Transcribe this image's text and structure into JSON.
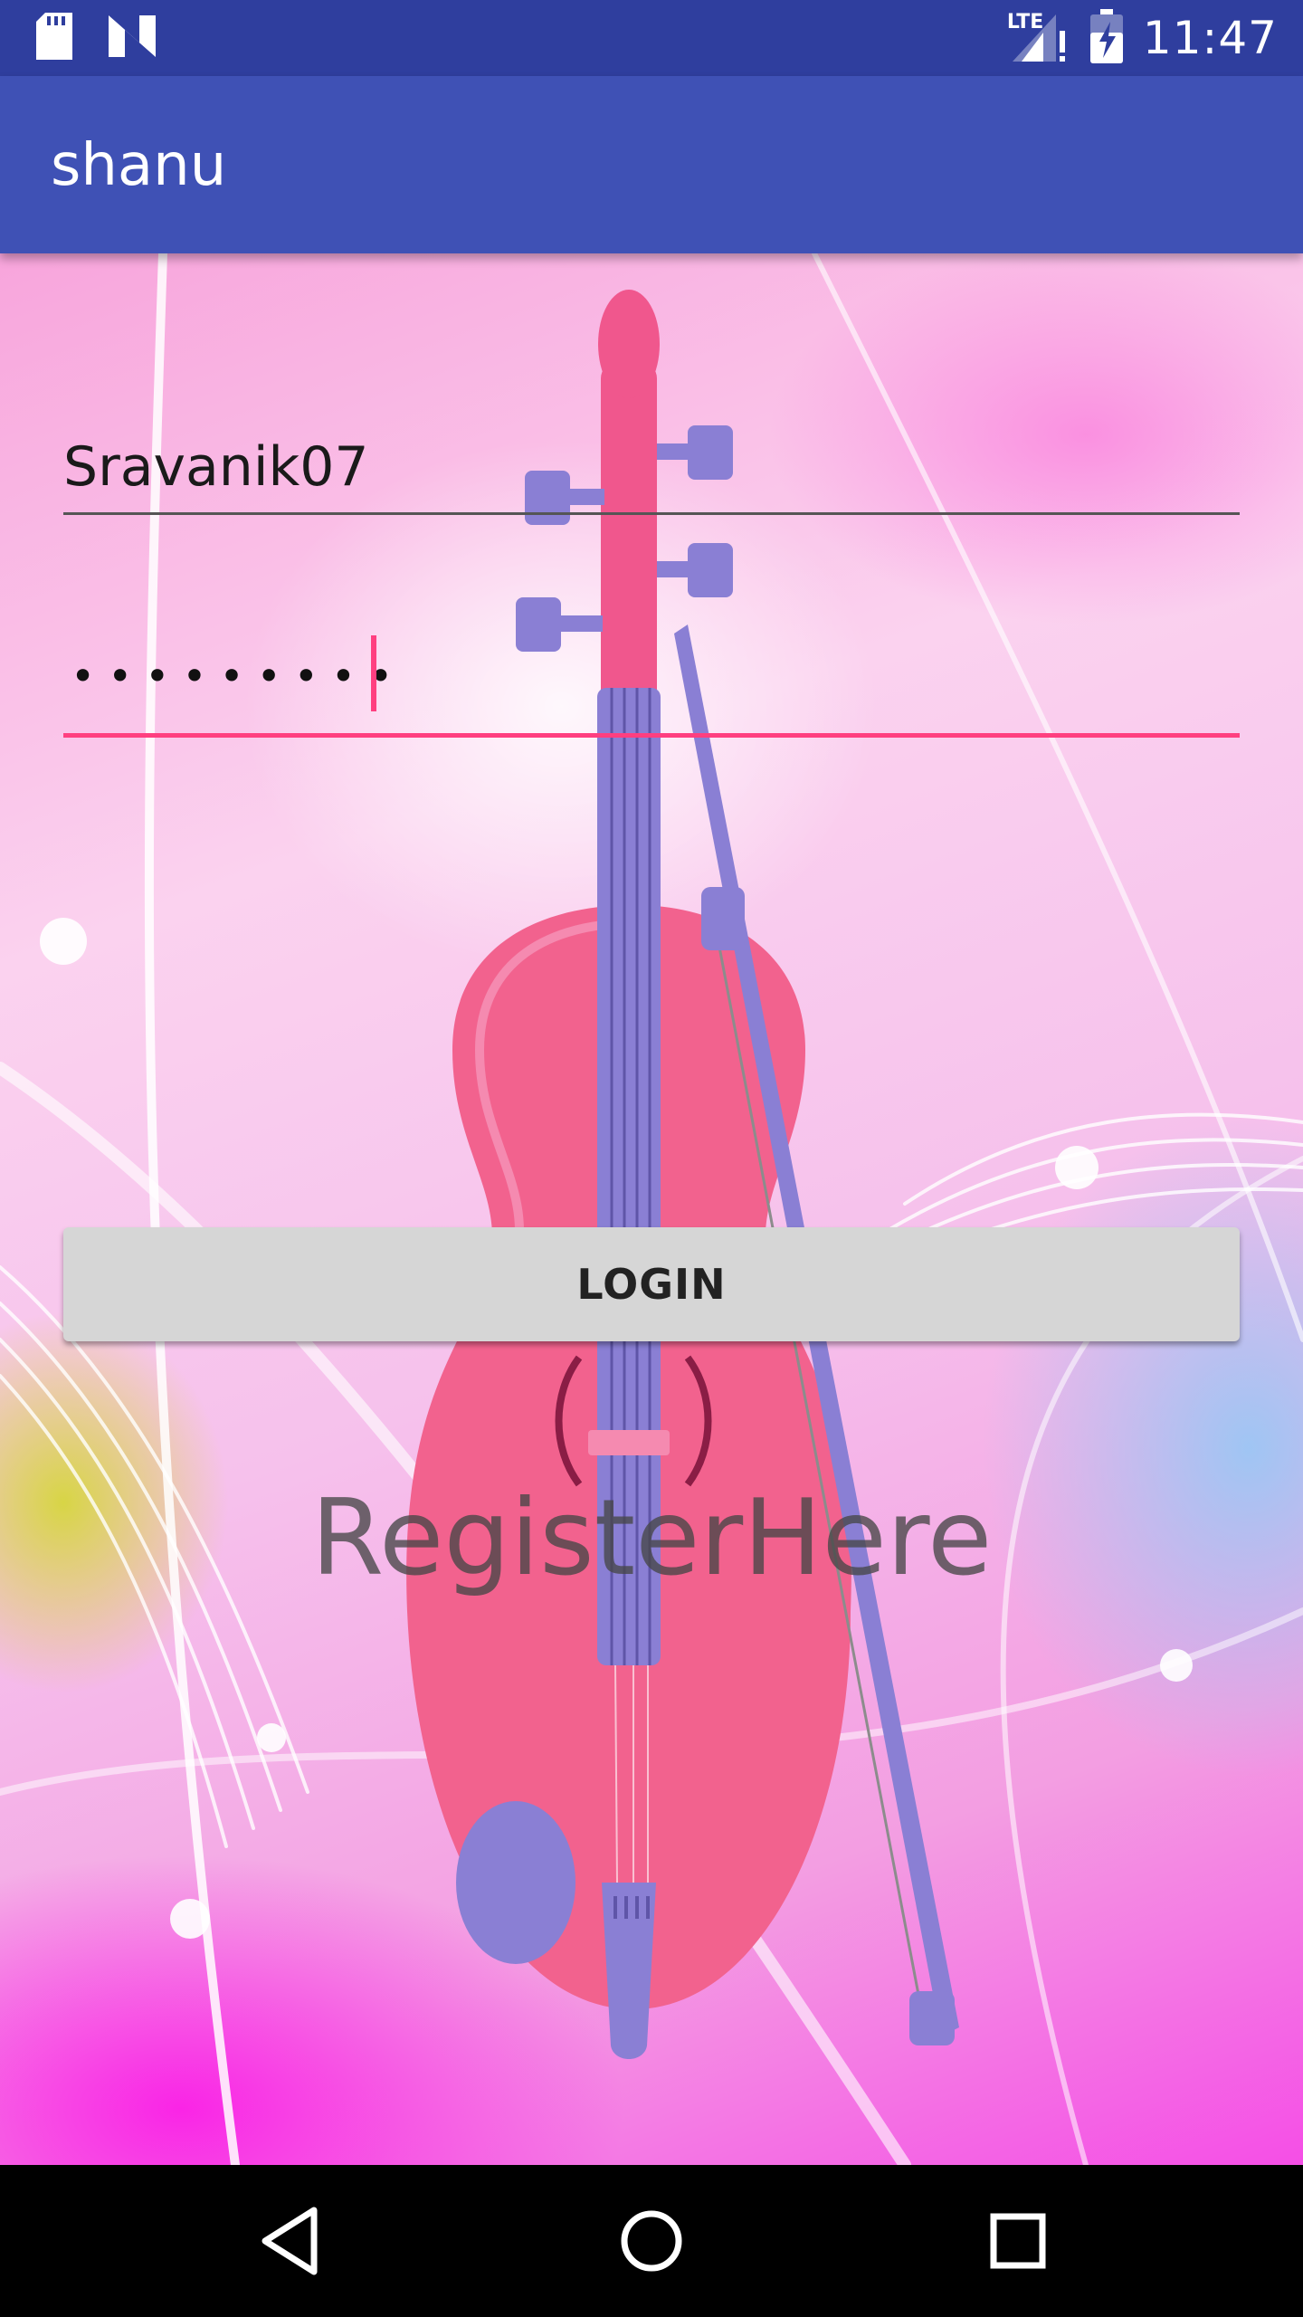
{
  "status_bar": {
    "time": "11:47",
    "network_label": "LTE",
    "icons": [
      "sd-card-icon",
      "n-notification-icon",
      "lte-signal-icon",
      "battery-icon"
    ]
  },
  "app_bar": {
    "title": "shanu"
  },
  "form": {
    "username_value": "Sravanik07",
    "password_value": "•••••••••",
    "login_label": "LOGIN",
    "register_label": "RegisterHere"
  },
  "nav_bar": {
    "icons": [
      "back-icon",
      "home-icon",
      "recents-icon"
    ]
  },
  "colors": {
    "status_bar": "#2f3e9e",
    "app_bar": "#3f51b5",
    "accent": "#ff3f80",
    "button": "#d6d6d6"
  }
}
